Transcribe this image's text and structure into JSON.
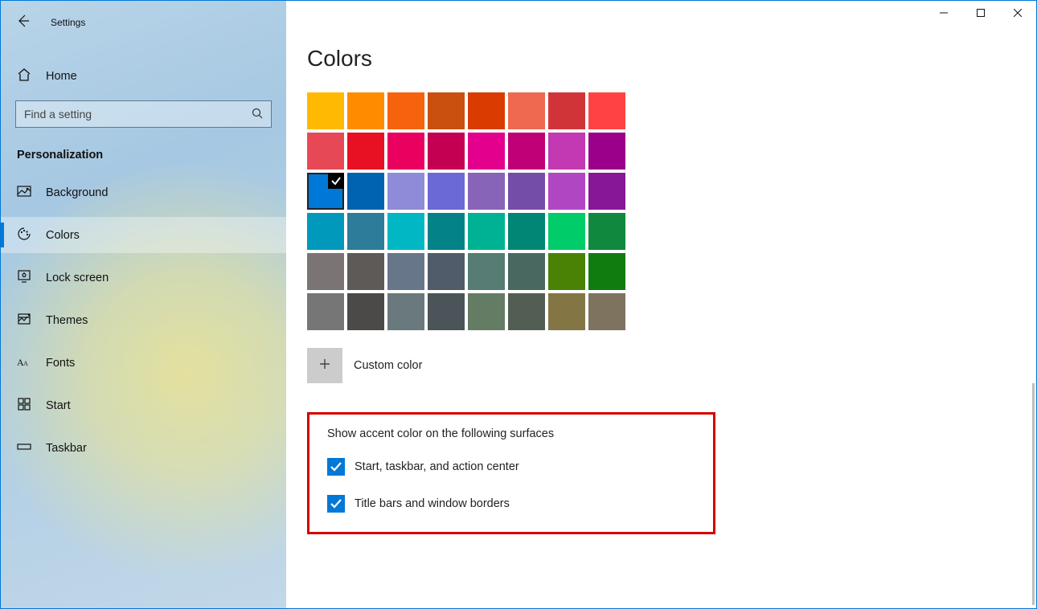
{
  "window": {
    "title": "Settings"
  },
  "sidebar": {
    "home_label": "Home",
    "search_placeholder": "Find a setting",
    "category_label": "Personalization",
    "items": [
      {
        "label": "Background"
      },
      {
        "label": "Colors"
      },
      {
        "label": "Lock screen"
      },
      {
        "label": "Themes"
      },
      {
        "label": "Fonts"
      },
      {
        "label": "Start"
      },
      {
        "label": "Taskbar"
      }
    ],
    "active_index": 1
  },
  "main": {
    "title": "Colors",
    "custom_color_label": "Custom color",
    "swatches": [
      "#FFB900",
      "#FF8C00",
      "#F7630C",
      "#CA5010",
      "#DA3B01",
      "#EF6950",
      "#D13438",
      "#FF4343",
      "#E74856",
      "#E81123",
      "#EA005E",
      "#C30052",
      "#E3008C",
      "#BF0077",
      "#C239B3",
      "#9A0089",
      "#0078D7",
      "#0063B1",
      "#8E8CD8",
      "#6B69D6",
      "#8764B8",
      "#744DA9",
      "#B146C2",
      "#881798",
      "#0099BC",
      "#2D7D9A",
      "#00B7C3",
      "#038387",
      "#00B294",
      "#018574",
      "#00CC6A",
      "#10893E",
      "#7A7574",
      "#5D5A58",
      "#68768A",
      "#515C6B",
      "#567C73",
      "#486860",
      "#498205",
      "#107C10",
      "#767676",
      "#4C4A48",
      "#69797E",
      "#4A5459",
      "#647C64",
      "#525E54",
      "#847545",
      "#7E735F"
    ],
    "selected_swatch_index": 16,
    "surfaces": {
      "heading": "Show accent color on the following surfaces",
      "options": [
        {
          "label": "Start, taskbar, and action center",
          "checked": true
        },
        {
          "label": "Title bars and window borders",
          "checked": true
        }
      ]
    }
  }
}
